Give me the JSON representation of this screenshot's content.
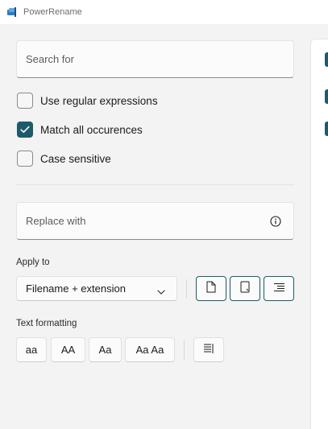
{
  "window": {
    "title": "PowerRename",
    "app_icon": "powerrename-app-icon"
  },
  "search": {
    "placeholder": "Search for"
  },
  "options": [
    {
      "label": "Use regular expressions",
      "checked": false
    },
    {
      "label": "Match all occurences",
      "checked": true
    },
    {
      "label": "Case sensitive",
      "checked": false
    }
  ],
  "replace": {
    "placeholder": "Replace with",
    "info_icon": "info-icon"
  },
  "apply_to": {
    "label": "Apply to",
    "selected": "Filename + extension",
    "toggles": [
      "file-icon",
      "document-icon",
      "enumerate-list-icon"
    ]
  },
  "text_formatting": {
    "label": "Text formatting",
    "buttons": [
      "aa",
      "AA",
      "Aa",
      "Aa Aa"
    ],
    "extra_icon": "enumerate-items-icon"
  },
  "colors": {
    "accent": "#1f5a6b",
    "background": "#f3f3f3",
    "surface": "#fbfbfb"
  }
}
